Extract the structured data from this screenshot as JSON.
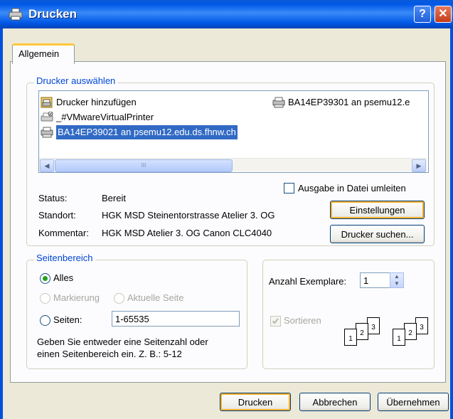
{
  "window": {
    "title": "Drucken",
    "help_label": "?",
    "close_label": "✕"
  },
  "tabs": [
    {
      "label": "Allgemein"
    }
  ],
  "printer_select": {
    "legend": "Drucker auswählen",
    "printers": [
      {
        "name": "Drucker hinzufügen",
        "icon": "add-printer-icon"
      },
      {
        "name": "BA14EP39301 an psemu12.e",
        "icon": "network-printer-icon"
      },
      {
        "name": "_#VMwareVirtualPrinter",
        "icon": "default-printer-icon"
      },
      {
        "name": "BA14EP39021 an psemu12.edu.ds.fhnw.ch",
        "icon": "network-printer-icon",
        "selected": true
      }
    ],
    "scroll_thumb_grip": "III",
    "status_label": "Status:",
    "status_value": "Bereit",
    "location_label": "Standort:",
    "location_value": "HGK MSD Steinentorstrasse Atelier 3. OG",
    "comment_label": "Kommentar:",
    "comment_value": "HGK MSD Atelier 3. OG Canon CLC4040",
    "print_to_file_label": "Ausgabe in Datei umleiten",
    "print_to_file_checked": false,
    "settings_button": "Einstellungen",
    "find_printer_button": "Drucker suchen..."
  },
  "page_range": {
    "legend": "Seitenbereich",
    "all_label": "Alles",
    "selection_label": "Markierung",
    "current_page_label": "Aktuelle Seite",
    "pages_label": "Seiten:",
    "pages_value": "1-65535",
    "help_text_line1": "Geben Sie entweder eine Seitenzahl oder",
    "help_text_line2": "einen Seitenbereich ein. Z. B.: 5-12",
    "selected": "all"
  },
  "copies": {
    "label": "Anzahl Exemplare:",
    "value": "1",
    "collate_label": "Sortieren",
    "collate_checked": true,
    "collate_enabled": false,
    "page_numbers": [
      "1",
      "2",
      "3"
    ]
  },
  "buttons": {
    "print": "Drucken",
    "cancel": "Abbrechen",
    "apply": "Übernehmen"
  },
  "colors": {
    "titlebar": "#0058E6",
    "accent": "#0046D5",
    "selection": "#316AC5",
    "window_bg": "#ECE9D8"
  }
}
